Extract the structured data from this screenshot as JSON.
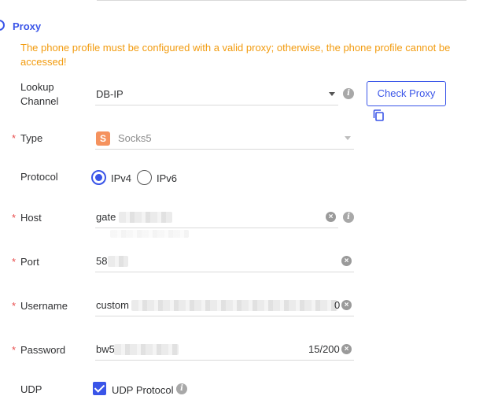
{
  "section": {
    "title": "Proxy",
    "warning": "The phone profile must be configured with a valid proxy; otherwise, the phone profile cannot be accessed!"
  },
  "lookup_channel": {
    "label_line1": "Lookup",
    "label_line2": "Channel",
    "value": "DB-IP",
    "info_icon": "info-icon"
  },
  "check_proxy": {
    "label": "Check Proxy",
    "copy_icon": "copy-icon"
  },
  "type": {
    "required_mark": "*",
    "label": "Type",
    "badge": "S",
    "value": "Socks5"
  },
  "protocol": {
    "label": "Protocol",
    "options": [
      {
        "label": "IPv4",
        "checked": true
      },
      {
        "label": "IPv6",
        "checked": false
      }
    ]
  },
  "host": {
    "required_mark": "*",
    "label": "Host",
    "value_visible": "gate"
  },
  "port": {
    "required_mark": "*",
    "label": "Port",
    "value_visible": "58"
  },
  "username": {
    "required_mark": "*",
    "label": "Username",
    "value_visible": "custom",
    "value_tail": "0"
  },
  "password": {
    "required_mark": "*",
    "label": "Password",
    "value_visible": "bw5",
    "counter": "15/200"
  },
  "udp": {
    "label": "UDP",
    "checkbox_label": "UDP Protocol",
    "checked": true
  },
  "colors": {
    "accent": "#3a55e8",
    "warning": "#f29b0e",
    "required": "#e84d4d",
    "badge": "#f5925e"
  }
}
